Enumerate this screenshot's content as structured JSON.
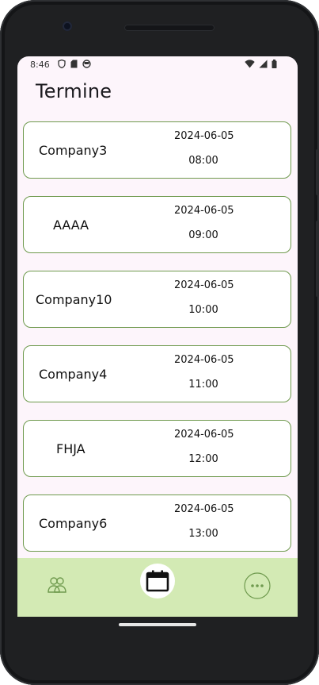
{
  "status_bar": {
    "time": "8:46"
  },
  "page": {
    "title": "Termine"
  },
  "appointments": [
    {
      "name": "Company3",
      "date": "2024-06-05",
      "time": "08:00"
    },
    {
      "name": "AAAA",
      "date": "2024-06-05",
      "time": "09:00"
    },
    {
      "name": "Company10",
      "date": "2024-06-05",
      "time": "10:00"
    },
    {
      "name": "Company4",
      "date": "2024-06-05",
      "time": "11:00"
    },
    {
      "name": "FHJA",
      "date": "2024-06-05",
      "time": "12:00"
    },
    {
      "name": "Company6",
      "date": "2024-06-05",
      "time": "13:00"
    }
  ],
  "bottom_nav": {
    "items": [
      {
        "icon": "people-icon"
      },
      {
        "icon": "calendar-icon",
        "selected": true
      },
      {
        "icon": "more-horizontal-icon"
      }
    ]
  },
  "colors": {
    "screen_bg": "#fdf5fb",
    "card_border": "#6f9a4e",
    "nav_bg": "#d3eab4",
    "nav_icon": "#6f9a4e"
  }
}
